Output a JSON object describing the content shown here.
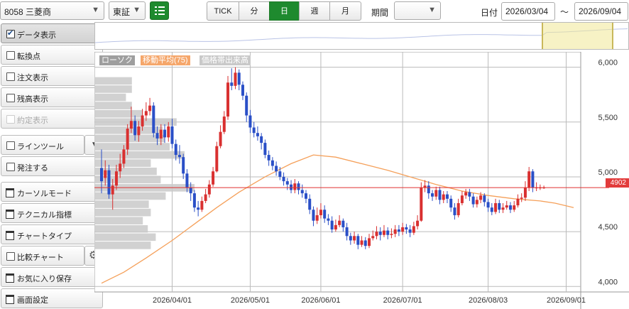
{
  "header": {
    "symbol": "8058 三菱商",
    "market": "東証",
    "periods": [
      "TICK",
      "分",
      "日",
      "週",
      "月"
    ],
    "period_label": "期間",
    "period_value": "",
    "date_label": "日付",
    "date_from": "2026/03/04",
    "date_sep": "〜",
    "date_to": "2026/09/04"
  },
  "sidebar": {
    "items": [
      {
        "label": "データ表示",
        "kind": "check",
        "checked": true
      },
      {
        "label": "転換点",
        "kind": "check",
        "checked": false
      },
      {
        "label": "注文表示",
        "kind": "check",
        "checked": false
      },
      {
        "label": "残高表示",
        "kind": "check",
        "checked": false
      },
      {
        "label": "約定表示",
        "kind": "check",
        "checked": false,
        "disabled": true
      },
      {
        "label": "ラインツール",
        "kind": "check",
        "checked": false,
        "dropdown": true
      },
      {
        "label": "発注する",
        "kind": "check",
        "checked": false
      },
      {
        "label": "カーソルモード",
        "kind": "window"
      },
      {
        "label": "テクニカル指標",
        "kind": "window"
      },
      {
        "label": "チャートタイプ",
        "kind": "window"
      },
      {
        "label": "比較チャート",
        "kind": "check",
        "checked": false,
        "gear": true
      },
      {
        "label": "お気に入り保存",
        "kind": "window"
      },
      {
        "label": "画面設定",
        "kind": "window"
      }
    ]
  },
  "chart_data": {
    "type": "candlestick",
    "legend": [
      "ローソク",
      "移動平均(75)",
      "価格帯出来高"
    ],
    "y_ticks": [
      "6,000",
      "5,500",
      "5,000",
      "4,500",
      "4,000"
    ],
    "y_tick_values": [
      6000,
      5500,
      5000,
      4500,
      4000
    ],
    "ylim": [
      3950,
      6140
    ],
    "x_ticks": [
      {
        "label": "2026/04/01",
        "index": 19
      },
      {
        "label": "2026/05/01",
        "index": 40
      },
      {
        "label": "2026/06/01",
        "index": 59
      },
      {
        "label": "2026/07/01",
        "index": 81
      },
      {
        "label": "2026/08/03",
        "index": 104
      },
      {
        "label": "2026/09/01",
        "index": 125
      }
    ],
    "current_price": "4902",
    "current_price_value": 4902,
    "n_bars": 128,
    "keys_ohlc": [
      [
        5080,
        4960,
        5250,
        4850
      ],
      [
        4990,
        5060,
        5150,
        4920
      ],
      [
        5060,
        4840,
        5110,
        4800
      ],
      [
        4840,
        4920,
        4980,
        4700
      ],
      [
        4920,
        5050,
        5110,
        4880
      ],
      [
        5050,
        5120,
        5210,
        4990
      ],
      [
        5120,
        5250,
        5290,
        5080
      ],
      [
        5250,
        5440,
        5480,
        5200
      ],
      [
        5440,
        5510,
        5640,
        5400
      ],
      [
        5510,
        5380,
        5560,
        5330
      ],
      [
        5380,
        5460,
        5510,
        5320
      ],
      [
        5460,
        5560,
        5620,
        5420
      ],
      [
        5560,
        5600,
        5680,
        5510
      ],
      [
        5600,
        5650,
        5720,
        5560
      ],
      [
        5650,
        5400,
        5680,
        5360
      ],
      [
        5400,
        5350,
        5460,
        5290
      ],
      [
        5350,
        5430,
        5480,
        5290
      ],
      [
        5430,
        5360,
        5480,
        5310
      ],
      [
        5360,
        5460,
        5500,
        5320
      ],
      [
        5460,
        5300,
        5530,
        5260
      ],
      [
        5300,
        5200,
        5340,
        5150
      ],
      [
        5200,
        5180,
        5290,
        5120
      ],
      [
        5180,
        5030,
        5210,
        4980
      ],
      [
        5030,
        4900,
        5070,
        4860
      ],
      [
        4900,
        4850,
        4950,
        4780
      ],
      [
        4850,
        4720,
        4880,
        4680
      ],
      [
        4720,
        4700,
        4780,
        4640
      ],
      [
        4700,
        4780,
        4820,
        4680
      ],
      [
        4780,
        4840,
        4890,
        4760
      ],
      [
        4840,
        4930,
        4970,
        4810
      ],
      [
        4930,
        5050,
        5090,
        4910
      ],
      [
        5050,
        5280,
        5320,
        5040
      ],
      [
        5280,
        5410,
        5470,
        5260
      ],
      [
        5410,
        5550,
        5600,
        5390
      ],
      [
        5550,
        5860,
        5920,
        5520
      ],
      [
        5860,
        5830,
        5990,
        5790
      ],
      [
        5830,
        5950,
        6000,
        5800
      ],
      [
        5950,
        5840,
        5980,
        5790
      ],
      [
        5840,
        5740,
        5870,
        5700
      ],
      [
        5740,
        5560,
        5770,
        5500
      ],
      [
        5560,
        5450,
        5610,
        5400
      ],
      [
        5450,
        5400,
        5500,
        5360
      ],
      [
        5400,
        5370,
        5460,
        5330
      ],
      [
        5370,
        5310,
        5400,
        5250
      ],
      [
        5310,
        5200,
        5340,
        5170
      ],
      [
        5200,
        5150,
        5240,
        5100
      ],
      [
        5150,
        5100,
        5180,
        5060
      ],
      [
        5100,
        5050,
        5140,
        5010
      ],
      [
        5050,
        5000,
        5090,
        4970
      ],
      [
        5000,
        4960,
        5040,
        4920
      ],
      [
        4960,
        4930,
        4990,
        4880
      ],
      [
        4930,
        4880,
        4970,
        4850
      ],
      [
        4880,
        4940,
        4980,
        4850
      ],
      [
        4940,
        4880,
        4960,
        4840
      ],
      [
        4880,
        4850,
        4930,
        4810
      ],
      [
        4850,
        4800,
        4880,
        4760
      ],
      [
        4800,
        4700,
        4840,
        4660
      ],
      [
        4700,
        4600,
        4730,
        4550
      ],
      [
        4600,
        4650,
        4720,
        4570
      ],
      [
        4650,
        4700,
        4760,
        4620
      ],
      [
        4700,
        4620,
        4740,
        4580
      ],
      [
        4620,
        4600,
        4660,
        4560
      ],
      [
        4600,
        4520,
        4640,
        4490
      ],
      [
        4520,
        4560,
        4610,
        4500
      ],
      [
        4560,
        4600,
        4650,
        4540
      ],
      [
        4600,
        4540,
        4620,
        4500
      ],
      [
        4540,
        4460,
        4580,
        4420
      ],
      [
        4460,
        4420,
        4490,
        4380
      ],
      [
        4420,
        4460,
        4500,
        4390
      ],
      [
        4460,
        4380,
        4480,
        4340
      ],
      [
        4380,
        4420,
        4460,
        4360
      ],
      [
        4420,
        4370,
        4450,
        4340
      ],
      [
        4370,
        4440,
        4480,
        4350
      ],
      [
        4440,
        4460,
        4510,
        4420
      ],
      [
        4460,
        4500,
        4550,
        4430
      ],
      [
        4500,
        4470,
        4540,
        4420
      ],
      [
        4470,
        4510,
        4560,
        4450
      ],
      [
        4510,
        4470,
        4540,
        4430
      ],
      [
        4470,
        4480,
        4530,
        4440
      ],
      [
        4480,
        4520,
        4560,
        4450
      ],
      [
        4520,
        4500,
        4560,
        4460
      ],
      [
        4500,
        4540,
        4580,
        4470
      ],
      [
        4540,
        4520,
        4570,
        4480
      ],
      [
        4520,
        4490,
        4560,
        4450
      ],
      [
        4490,
        4550,
        4590,
        4470
      ],
      [
        4550,
        4600,
        4650,
        4520
      ],
      [
        4600,
        4900,
        4950,
        4590
      ],
      [
        4900,
        4920,
        4970,
        4860
      ],
      [
        4920,
        4850,
        4960,
        4800
      ],
      [
        4850,
        4820,
        4880,
        4780
      ],
      [
        4820,
        4880,
        4910,
        4790
      ],
      [
        4880,
        4790,
        4910,
        4750
      ],
      [
        4790,
        4840,
        4870,
        4760
      ],
      [
        4840,
        4800,
        4870,
        4760
      ],
      [
        4800,
        4720,
        4830,
        4680
      ],
      [
        4720,
        4650,
        4760,
        4610
      ],
      [
        4650,
        4760,
        4800,
        4630
      ],
      [
        4760,
        4830,
        4870,
        4740
      ],
      [
        4830,
        4860,
        4890,
        4800
      ],
      [
        4860,
        4820,
        4890,
        4780
      ],
      [
        4820,
        4750,
        4850,
        4720
      ],
      [
        4750,
        4790,
        4820,
        4720
      ],
      [
        4790,
        4830,
        4860,
        4760
      ],
      [
        4830,
        4770,
        4850,
        4730
      ],
      [
        4770,
        4720,
        4800,
        4680
      ],
      [
        4720,
        4680,
        4760,
        4650
      ],
      [
        4680,
        4760,
        4800,
        4660
      ],
      [
        4760,
        4700,
        4790,
        4670
      ],
      [
        4700,
        4720,
        4760,
        4670
      ],
      [
        4720,
        4740,
        4780,
        4700
      ],
      [
        4740,
        4700,
        4770,
        4670
      ],
      [
        4700,
        4740,
        4780,
        4680
      ],
      [
        4740,
        4800,
        4840,
        4720
      ],
      [
        4800,
        4810,
        4850,
        4770
      ],
      [
        4810,
        4900,
        4960,
        4780
      ],
      [
        4900,
        5050,
        5090,
        4870
      ],
      [
        5050,
        4902,
        5070,
        4860
      ],
      [
        4902,
        4902,
        4950,
        4870
      ],
      [
        4902,
        4902,
        4930,
        4880
      ],
      [
        4902,
        4902,
        4920,
        4890
      ],
      [
        4902,
        4902,
        4910,
        4895
      ],
      [
        4902,
        4902,
        4910,
        4895
      ],
      [
        4902,
        4902,
        4910,
        4895
      ],
      [
        4902,
        4902,
        4910,
        4895
      ],
      [
        4902,
        4902,
        4910,
        4895
      ],
      [
        4902,
        4902,
        4910,
        4895
      ],
      [
        4902,
        4902,
        4910,
        4895
      ],
      [
        4902,
        4902,
        4910,
        4895
      ]
    ],
    "ma75": [
      [
        0,
        4030
      ],
      [
        6,
        4130
      ],
      [
        12,
        4260
      ],
      [
        19,
        4420
      ],
      [
        25,
        4570
      ],
      [
        31,
        4720
      ],
      [
        37,
        4860
      ],
      [
        44,
        5000
      ],
      [
        51,
        5120
      ],
      [
        57,
        5200
      ],
      [
        63,
        5180
      ],
      [
        70,
        5120
      ],
      [
        77,
        5060
      ],
      [
        84,
        4990
      ],
      [
        90,
        4930
      ],
      [
        97,
        4870
      ],
      [
        104,
        4830
      ],
      [
        111,
        4800
      ],
      [
        118,
        4780
      ],
      [
        122,
        4760
      ],
      [
        127,
        4720
      ]
    ],
    "volume_profile": [
      {
        "price": 5875,
        "volume": 0.37
      },
      {
        "price": 5800,
        "volume": 0.37
      },
      {
        "price": 5725,
        "volume": 0.31
      },
      {
        "price": 5650,
        "volume": 0.37
      },
      {
        "price": 5575,
        "volume": 0.48
      },
      {
        "price": 5500,
        "volume": 0.82
      },
      {
        "price": 5425,
        "volume": 0.68
      },
      {
        "price": 5350,
        "volume": 0.7
      },
      {
        "price": 5275,
        "volume": 0.75
      },
      {
        "price": 5200,
        "volume": 0.9
      },
      {
        "price": 5125,
        "volume": 0.56
      },
      {
        "price": 5050,
        "volume": 0.62
      },
      {
        "price": 4975,
        "volume": 0.66
      },
      {
        "price": 4900,
        "volume": 1.0
      },
      {
        "price": 4825,
        "volume": 0.71
      },
      {
        "price": 4750,
        "volume": 0.54
      },
      {
        "price": 4675,
        "volume": 0.56
      },
      {
        "price": 4600,
        "volume": 0.48
      },
      {
        "price": 4525,
        "volume": 0.53
      },
      {
        "price": 4450,
        "volume": 0.61
      },
      {
        "price": 4375,
        "volume": 0.56
      }
    ]
  }
}
